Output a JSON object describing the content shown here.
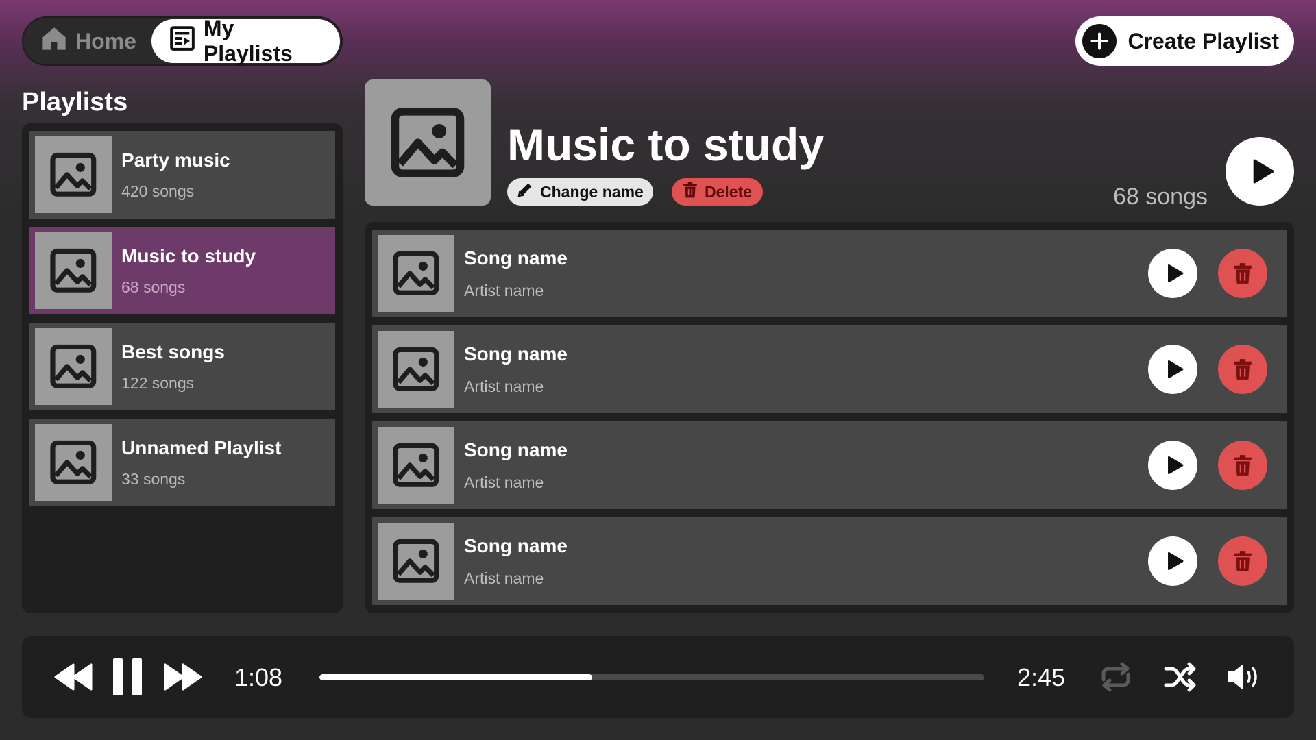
{
  "colors": {
    "accent": "#6e3a6a",
    "danger": "#e05252",
    "danger_text": "#5c0b0b",
    "panel": "#1f1f1f",
    "row": "#474747"
  },
  "nav": {
    "home_label": "Home",
    "home_icon": "house-icon",
    "playlists_label": "My Playlists",
    "playlists_icon": "playlist-icon",
    "active": "My Playlists"
  },
  "create_button": {
    "label": "Create Playlist",
    "icon": "plus-circle-icon"
  },
  "sidebar": {
    "title": "Playlists",
    "items": [
      {
        "name": "Party music",
        "count": "420 songs",
        "active": false
      },
      {
        "name": "Music to study",
        "count": "68 songs",
        "active": true
      },
      {
        "name": "Best songs",
        "count": "122 songs",
        "active": false
      },
      {
        "name": "Unnamed Playlist",
        "count": "33 songs",
        "active": false
      }
    ]
  },
  "playlist": {
    "title": "Music to study",
    "change_name_label": "Change name",
    "delete_label": "Delete",
    "song_count": "68 songs",
    "songs": [
      {
        "name": "Song name",
        "artist": "Artist name"
      },
      {
        "name": "Song name",
        "artist": "Artist name"
      },
      {
        "name": "Song name",
        "artist": "Artist name"
      },
      {
        "name": "Song name",
        "artist": "Artist name"
      }
    ]
  },
  "player": {
    "current_time": "1:08",
    "total_time": "2:45",
    "progress_fraction": 0.41,
    "state": "playing",
    "repeat_enabled": false,
    "shuffle_enabled": true
  }
}
